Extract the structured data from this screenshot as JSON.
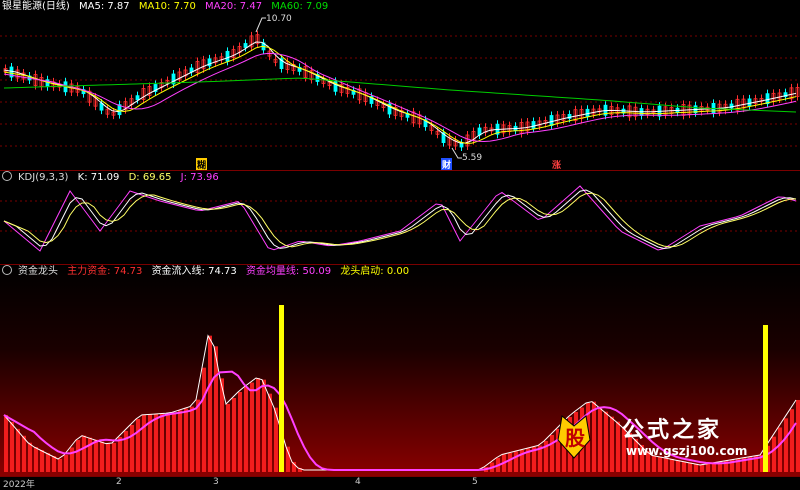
{
  "main": {
    "title": "银星能源(日线)",
    "ma5": "MA5: 7.87",
    "ma10": "MA10: 7.70",
    "ma20": "MA20: 7.47",
    "ma60": "MA60: 7.09",
    "high_label": "10.70",
    "low_label": "5.59",
    "tag_a": "糊",
    "tag_b": "财",
    "tag_c": "涨",
    "colors": {
      "ma5": "#ffffff",
      "ma10": "#ffff00",
      "ma20": "#ff40ff",
      "ma60": "#00cc00",
      "up": "#ff3030",
      "down": "#00ffff"
    }
  },
  "kdj": {
    "title": "KDJ(9,3,3)",
    "k": "K: 71.09",
    "d": "D: 69.65",
    "j": "J: 73.96"
  },
  "capital": {
    "title": "资金龙头",
    "main_force": "主力资金: 74.73",
    "inflow": "资金流入线: 74.73",
    "avg": "资金均量线: 50.09",
    "dragon": "龙头启动: 0.00"
  },
  "axis": {
    "year": "2022年",
    "m2": "2",
    "m3": "3",
    "m4": "4",
    "m5": "5"
  },
  "watermark": {
    "char": "股",
    "text": "公式之家",
    "url": "www.gszj100.com"
  }
}
